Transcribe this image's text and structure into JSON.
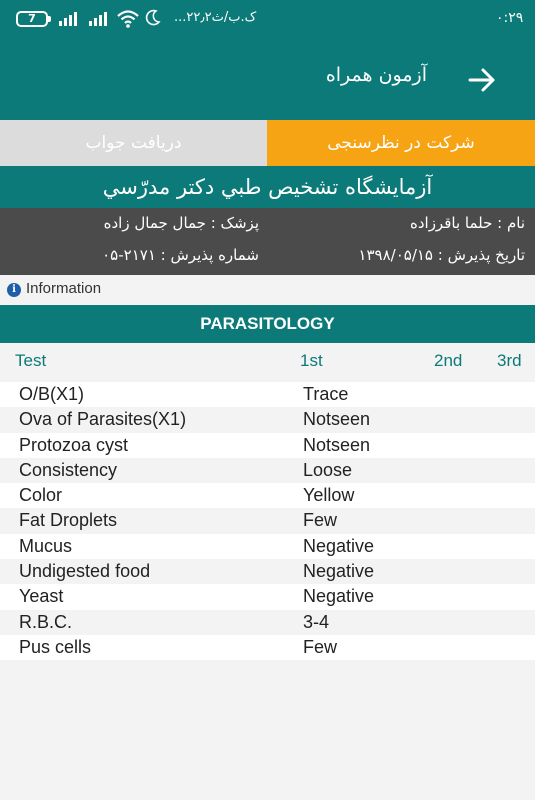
{
  "status_bar": {
    "time": "۰:۲۹",
    "carrier": "...۲۲٫۲ک.ب/ث",
    "battery": "7"
  },
  "app_bar": {
    "title": "آزمون همراه"
  },
  "tabs": [
    {
      "label": "شرکت در نظرسنجی",
      "active": true
    },
    {
      "label": "دریافت جواب",
      "active": false
    }
  ],
  "lab_name": "آزمایشگاه تشخیص طبي دکتر مدرّسي",
  "patient": {
    "name": "نام : حلما باقرزاده",
    "doctor": "پزشک : جمال جمال زاده",
    "admission_date": "تاریخ پذیرش : ۱۳۹۸/۰۵/۱۵",
    "admission_number": "شماره پذیرش : ۲۱۷۱-۰۵"
  },
  "info_label": "Information",
  "section_title": "PARASITOLOGY",
  "table": {
    "headers": [
      "Test",
      "1st",
      "2nd",
      "3rd"
    ],
    "rows": [
      {
        "test": "O/B(X1)",
        "first": "Trace",
        "second": "",
        "third": ""
      },
      {
        "test": "Ova of Parasites(X1)",
        "first": "Notseen",
        "second": "",
        "third": ""
      },
      {
        "test": "Protozoa cyst",
        "first": "Notseen",
        "second": "",
        "third": ""
      },
      {
        "test": "Consistency",
        "first": "Loose",
        "second": "",
        "third": ""
      },
      {
        "test": "Color",
        "first": "Yellow",
        "second": "",
        "third": ""
      },
      {
        "test": "Fat Droplets",
        "first": "Few",
        "second": "",
        "third": ""
      },
      {
        "test": "Mucus",
        "first": "Negative",
        "second": "",
        "third": ""
      },
      {
        "test": "Undigested food",
        "first": "Negative",
        "second": "",
        "third": ""
      },
      {
        "test": "Yeast",
        "first": "Negative",
        "second": "",
        "third": ""
      },
      {
        "test": "R.B.C.",
        "first": "3-4",
        "second": "",
        "third": ""
      },
      {
        "test": "Pus cells",
        "first": "Few",
        "second": "",
        "third": ""
      }
    ]
  },
  "colors": {
    "primary": "#0b7a78",
    "accent": "#f6a314",
    "tab_inactive": "#dcdcdc",
    "patient_bg": "#4b4b4b"
  },
  "icons": {
    "back": "arrow-right-icon",
    "info": "info-icon",
    "wifi": "wifi-icon",
    "signal": "signal-icon",
    "moon": "moon-icon",
    "battery": "battery-icon"
  }
}
